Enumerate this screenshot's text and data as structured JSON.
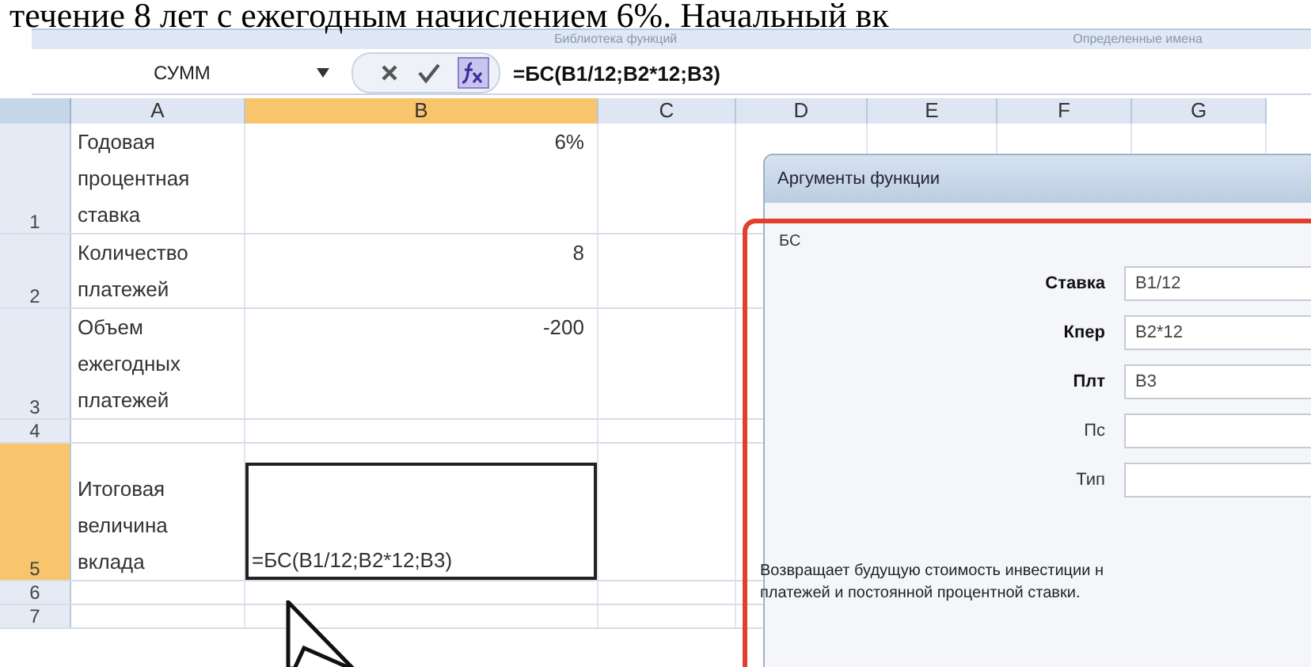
{
  "caption": "течение 8 лет с ежегодным начислением 6%. Начальный вк",
  "ribbon_groups": [
    "Библиотека функций",
    "Определенные имена"
  ],
  "formula_bar": {
    "name_box": "СУММ",
    "formula": "=БС(B1/12;B2*12;B3)"
  },
  "columns": [
    {
      "label": "A",
      "selected": false
    },
    {
      "label": "B",
      "selected": true
    },
    {
      "label": "C",
      "selected": false
    },
    {
      "label": "D",
      "selected": false
    },
    {
      "label": "E",
      "selected": false
    },
    {
      "label": "F",
      "selected": false
    },
    {
      "label": "G",
      "selected": false
    }
  ],
  "rows": [
    {
      "number": "1",
      "selected": false,
      "label": "Годовая процентная ставка",
      "value": "6%"
    },
    {
      "number": "2",
      "selected": false,
      "label": "Количество платежей",
      "value": "8"
    },
    {
      "number": "3",
      "selected": false,
      "label": "Объем ежегодных платежей",
      "value": "-200"
    },
    {
      "number": "4",
      "selected": false
    },
    {
      "number": "5",
      "selected": true,
      "label": "Итоговая величина вклада",
      "editing": "=БС(B1/12;B2*12;B3)"
    },
    {
      "number": "6",
      "selected": false
    },
    {
      "number": "7",
      "selected": false
    }
  ],
  "dialog": {
    "title": "Аргументы функции",
    "function": "БС",
    "arguments": [
      {
        "label": "Ставка",
        "required": true,
        "value": "B1/12"
      },
      {
        "label": "Кпер",
        "required": true,
        "value": "B2*12"
      },
      {
        "label": "Плт",
        "required": true,
        "value": "B3"
      },
      {
        "label": "Пс",
        "required": false
      },
      {
        "label": "Тип",
        "required": false
      }
    ],
    "description": [
      "Возвращает будущую стоимость инвестиции н",
      "платежей и постоянной процентной ставки."
    ]
  }
}
